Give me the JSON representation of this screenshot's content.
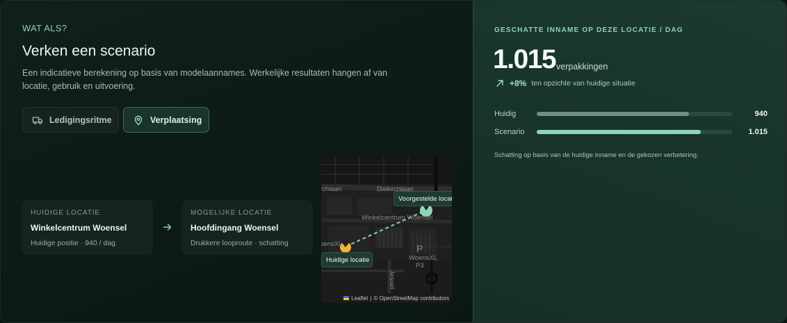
{
  "scenario": {
    "eyebrow": "WAT ALS?",
    "title": "Verken een scenario",
    "description": "Een indicatieve berekening op basis van modelaannames. Werkelijke resultaten hangen af van locatie, gebruik en uitvoering.",
    "buttons": [
      {
        "label": "Ledigingsritme",
        "icon": "truck-icon",
        "active": false
      },
      {
        "label": "Verplaatsing",
        "icon": "map-pin-icon",
        "active": true
      }
    ],
    "current": {
      "label": "HUIDIGE LOCATIE",
      "name": "Winkelcentrum Woensel",
      "sub": "Huidige positie · 940 / dag"
    },
    "possible": {
      "label": "MOGELIJKE LOCATIE",
      "name": "Hoofdingang Woensel",
      "sub": "Drukkere looproute · schatting"
    }
  },
  "map": {
    "label_proposed": "Voorgestelde locatie",
    "label_current": "Huidige locatie",
    "streets": [
      "Diekirchlaan",
      "rchlaan",
      "Winkelcentrum Woensel",
      "oensXL",
      "WoensXL",
      "P",
      "P3",
      "Jesuel"
    ],
    "attribution_leaflet": "Leaflet",
    "attribution_sep": "|",
    "attribution_osm": "© OpenStreetMap contributors",
    "colors": {
      "proposed": "#8fd6b6",
      "current": "#f2b33d"
    }
  },
  "estimate": {
    "eyebrow": "GESCHATTE INNAME OP DEZE LOCATIE / DAG",
    "value": "1.015",
    "unit": "verpakkingen",
    "delta": "+8%",
    "delta_text": "ten opzichte van huidige situatie",
    "bars": [
      {
        "label": "Huidig",
        "value": "940",
        "fraction": 0.78
      },
      {
        "label": "Scenario",
        "value": "1.015",
        "fraction": 0.84
      }
    ],
    "max_fraction_basis": "relative",
    "note": "Schatting op basis van de huidige inname en de gekozen verbetering."
  },
  "colors": {
    "accent": "#8fd2b3",
    "left_bg": "#0e1a16",
    "right_bg": "#17332a"
  }
}
